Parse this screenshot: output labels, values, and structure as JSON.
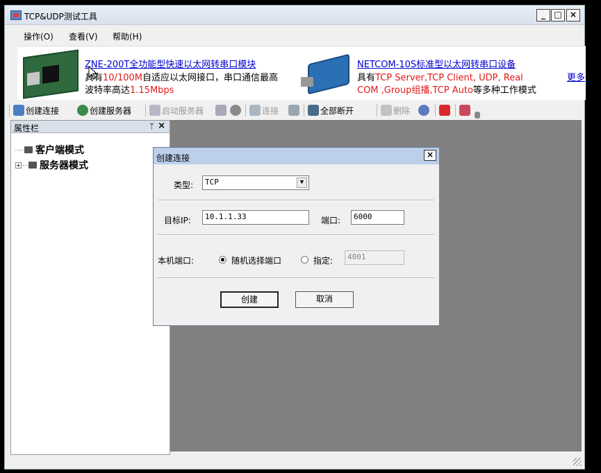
{
  "window": {
    "title": "TCP&UDP测试工具",
    "minimize": "_",
    "maximize": "□",
    "close": "×"
  },
  "menu": [
    "操作(O)",
    "查看(V)",
    "帮助(H)"
  ],
  "banner": {
    "promo1": {
      "link": "ZNE-200T全功能型快速以太网转串口模块",
      "line1_a": "具有",
      "line1_red": "10/100M",
      "line1_b": "自适应以太网接口，串口通信最高",
      "line2_a": "波特率高达",
      "line2_red": "1.15Mbps"
    },
    "promo2": {
      "link": "NETCOM-10S标准型以太网转串口设备",
      "line1_a": "具有",
      "line1_red": "TCP Server,TCP Client, UDP, Real",
      "line2_red": "COM ,Group组播,TCP Auto",
      "line2_b": "等多种工作模式"
    },
    "more": "更多"
  },
  "toolbar": {
    "create_connection": "创建连接",
    "create_server": "创建服务器",
    "start_server": "启动服务器",
    "connect": "连接",
    "disconnect_all": "全部断开",
    "delete": "删除"
  },
  "side_panel": {
    "title": "属性栏",
    "pin": "ᛘ",
    "close": "×",
    "tree": [
      {
        "label": "客户端模式"
      },
      {
        "label": "服务器模式",
        "expander": "+"
      }
    ]
  },
  "dialog": {
    "title": "创建连接",
    "close": "×",
    "type_label": "类型:",
    "type_value": "TCP",
    "target_ip_label": "目标IP:",
    "target_ip_value": "10.1.1.33",
    "port_label": "端口:",
    "port_value": "6000",
    "local_port_label": "本机端口:",
    "random_port_label": "随机选择端口",
    "specify_label": "指定:",
    "specify_value": "4001",
    "random_selected": true,
    "create_button": "创建",
    "cancel_button": "取消"
  },
  "colors": {
    "accent_red": "#e01818",
    "link_blue": "#0000d0",
    "workspace_gray": "#808080"
  }
}
